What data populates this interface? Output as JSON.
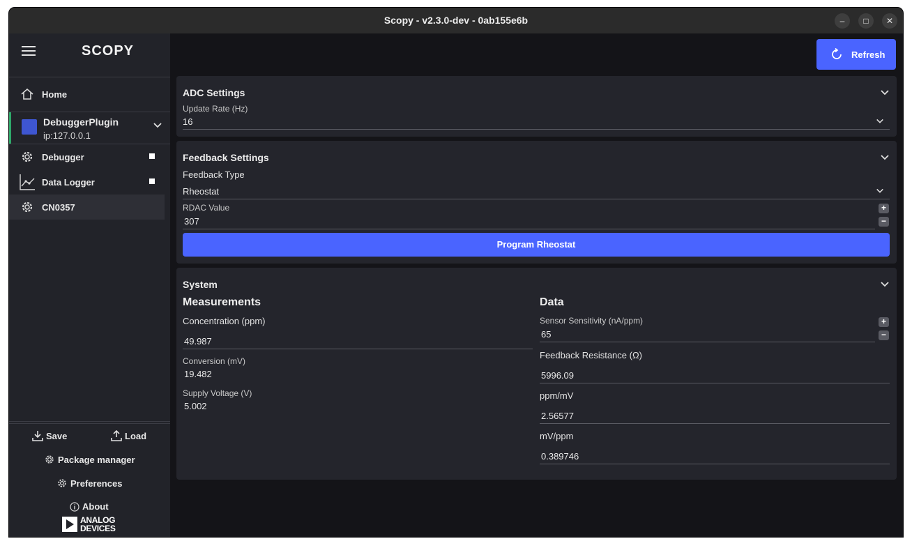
{
  "window": {
    "title": "Scopy - v2.3.0-dev - 0ab155e6b",
    "controls": {
      "minimize": "–",
      "maximize": "□",
      "close": "✕"
    }
  },
  "sidebar": {
    "logo": "SCOPY",
    "home": "Home",
    "device": {
      "name": "DebuggerPlugin",
      "ip": "ip:127.0.0.1"
    },
    "tools": [
      {
        "label": "Debugger",
        "icon": "gear-icon"
      },
      {
        "label": "Data Logger",
        "icon": "chart-icon"
      },
      {
        "label": "CN0357",
        "icon": "gear-icon"
      }
    ],
    "save": "Save",
    "load": "Load",
    "package_manager": "Package manager",
    "preferences": "Preferences",
    "about": "About",
    "brand": {
      "line1": "ANALOG",
      "line2": "DEVICES"
    }
  },
  "toolbar": {
    "refresh": "Refresh"
  },
  "adc": {
    "title": "ADC Settings",
    "update_rate_label": "Update Rate (Hz)",
    "update_rate_value": "16"
  },
  "feedback": {
    "title": "Feedback Settings",
    "type_label": "Feedback Type",
    "type_value": "Rheostat",
    "rdac_label": "RDAC Value",
    "rdac_value": "307",
    "program_button": "Program Rheostat"
  },
  "system": {
    "title": "System",
    "measurements": {
      "heading": "Measurements",
      "concentration_label": "Concentration (ppm)",
      "concentration_value": "49.987",
      "conversion_label": "Conversion (mV)",
      "conversion_value": "19.482",
      "supply_label": "Supply Voltage (V)",
      "supply_value": "5.002"
    },
    "data": {
      "heading": "Data",
      "sensitivity_label": "Sensor Sensitivity (nA/ppm)",
      "sensitivity_value": "65",
      "resistance_label": "Feedback Resistance (Ω)",
      "resistance_value": "5996.09",
      "ppm_mv_label": "ppm/mV",
      "ppm_mv_value": "2.56577",
      "mv_ppm_label": "mV/ppm",
      "mv_ppm_value": "0.389746"
    }
  },
  "colors": {
    "accent": "#4a64ff",
    "device_indicator": "#2ea86a",
    "panel": "#24252c",
    "background": "#141418"
  }
}
